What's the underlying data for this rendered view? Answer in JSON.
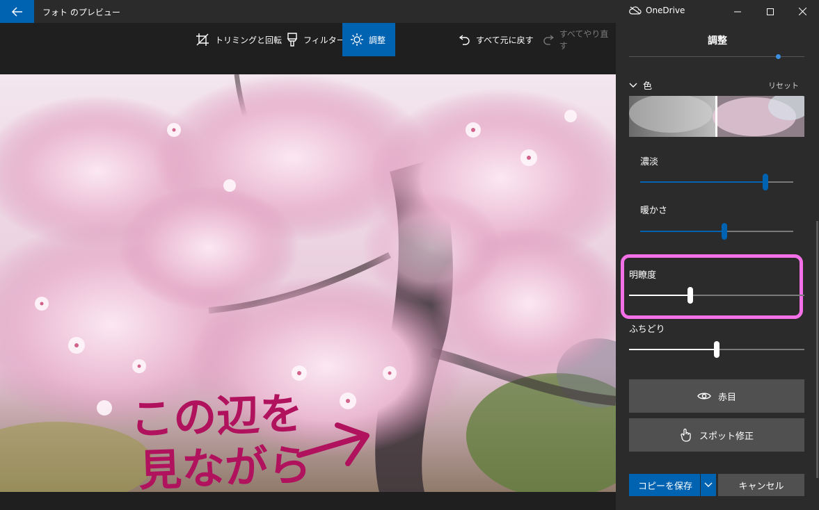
{
  "window": {
    "title": "フォト のプレビュー",
    "onedrive_label": "OneDrive"
  },
  "toolbar": {
    "crop_label": "トリミングと回転",
    "filter_label": "フィルター",
    "adjust_label": "調整",
    "undo_all_label": "すべて元に戻す",
    "redo_all_label": "すべてやり直す"
  },
  "photo": {
    "annotation_line1": "この辺を",
    "annotation_line2": "見ながら",
    "annotation_color": "#b0125e"
  },
  "panel": {
    "title": "調整",
    "color_section": "色",
    "reset_label": "リセット",
    "sliders": [
      {
        "label": "濃淡",
        "value": 0.82
      },
      {
        "label": "暖かさ",
        "value": 0.55
      },
      {
        "label": "明瞭度",
        "value": 0.35
      },
      {
        "label": "ふちどり",
        "value": 0.5
      }
    ],
    "red_eye_label": "赤目",
    "spot_fix_label": "スポット修正",
    "save_copy_label": "コピーを保存",
    "cancel_label": "キャンセル"
  },
  "colors": {
    "accent": "#0063b1",
    "highlight": "#f470e6"
  }
}
